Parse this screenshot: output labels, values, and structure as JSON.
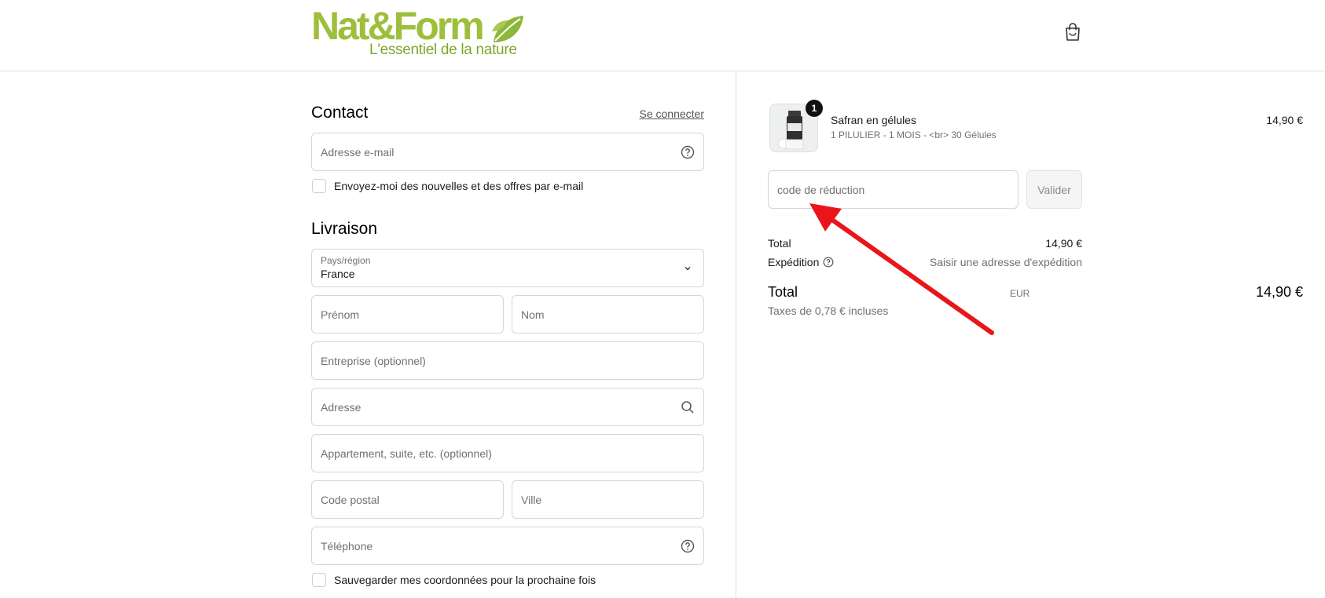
{
  "brand": {
    "name": "Nat&Form",
    "tagline": "L'essentiel de la nature",
    "color": "#9dbf3c"
  },
  "header": {
    "cart_icon": "shopping-bag-icon"
  },
  "contact": {
    "title": "Contact",
    "login_link": "Se connecter",
    "email_placeholder": "Adresse e-mail",
    "newsletter_label": "Envoyez-moi des nouvelles et des offres par e-mail"
  },
  "delivery": {
    "title": "Livraison",
    "country_label": "Pays/région",
    "country_value": "France",
    "first_name_placeholder": "Prénom",
    "last_name_placeholder": "Nom",
    "company_placeholder": "Entreprise (optionnel)",
    "address_placeholder": "Adresse",
    "apartment_placeholder": "Appartement, suite, etc. (optionnel)",
    "postal_placeholder": "Code postal",
    "city_placeholder": "Ville",
    "phone_placeholder": "Téléphone",
    "save_info_label": "Sauvegarder mes coordonnées pour la prochaine fois"
  },
  "order": {
    "item": {
      "quantity": "1",
      "name": "Safran en gélules",
      "variant": "1 PILULIER - 1 MOIS - <br> 30 Gélules",
      "price": "14,90 €"
    },
    "discount_placeholder": "code de réduction",
    "apply_label": "Valider",
    "subtotal_label": "Total",
    "subtotal_value": "14,90 €",
    "shipping_label": "Expédition",
    "shipping_value": "Saisir une adresse d'expédition",
    "total_label": "Total",
    "currency": "EUR",
    "total_value": "14,90 €",
    "tax_line": "Taxes de 0,78 € incluses"
  },
  "annotation": {
    "arrow_color": "#e8161b"
  }
}
